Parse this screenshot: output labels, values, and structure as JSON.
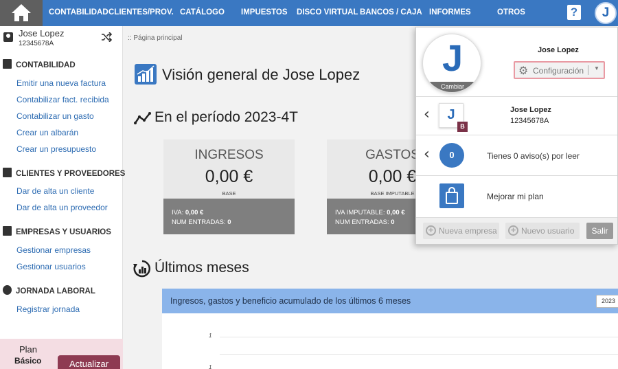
{
  "nav": {
    "items": [
      "CONTABILIDAD",
      "CLIENTES/PROV.",
      "CATÁLOGO",
      "IMPUESTOS",
      "DISCO VIRTUAL",
      "BANCOS / CAJA",
      "INFORMES",
      "OTROS"
    ],
    "help": "?",
    "user_initial": "J"
  },
  "sidebar": {
    "user_name": "Jose Lopez",
    "user_nif": "12345678A",
    "sections": [
      {
        "title": "CONTABILIDAD",
        "links": [
          "Emitir una nueva factura",
          "Contabilizar fact. recibida",
          "Contabilizar un gasto",
          "Crear un albarán",
          "Crear un presupuesto"
        ]
      },
      {
        "title": "CLIENTES Y PROVEEDORES",
        "links": [
          "Dar de alta un cliente",
          "Dar de alta un proveedor"
        ]
      },
      {
        "title": "EMPRESAS Y USUARIOS",
        "links": [
          "Gestionar empresas",
          "Gestionar usuarios"
        ]
      },
      {
        "title": "JORNADA LABORAL",
        "links": [
          "Registrar jornada"
        ]
      }
    ],
    "plan_label": "Plan",
    "plan_name": "Básico",
    "update_button": "Actualizar"
  },
  "main": {
    "breadcrumb": ":: Página principal",
    "title": "Visión general de Jose Lopez",
    "period_title": "En el período 2023-4T",
    "cards": [
      {
        "title": "INGRESOS",
        "value": "0,00 €",
        "sub": "BASE",
        "line1_label": "IVA:",
        "line1_value": "0,00 €",
        "line2_label": "NUM ENTRADAS:",
        "line2_value": "0"
      },
      {
        "title": "GASTOS",
        "value": "0,00 €",
        "sub": "BASE IMPUTABLE",
        "line1_label": "IVA IMPUTABLE:",
        "line1_value": "0,00 €",
        "line2_label": "NUM ENTRADAS:",
        "line2_value": "0"
      }
    ],
    "months_title": "Últimos meses",
    "chart": {
      "title": "Ingresos, gastos y beneficio acumulado de los últimos 6 meses",
      "year": "2023",
      "yticks": [
        "1",
        "1"
      ]
    }
  },
  "user_menu": {
    "avatar_initial": "J",
    "change_label": "Cambiar",
    "name": "Jose Lopez",
    "config_label": "Configuración",
    "company_initial": "J",
    "company_badge": "B",
    "company_name": "Jose Lopez",
    "company_nif": "12345678A",
    "notif_count": "0",
    "notif_text": "Tienes 0 aviso(s) por leer",
    "plan_text": "Mejorar mi plan",
    "new_company": "Nueva empresa",
    "new_user": "Nuevo usuario",
    "logout": "Salir"
  },
  "colors": {
    "nav": "#3a78c2",
    "accent": "#8e3a52",
    "highlight": "#e99aa3"
  }
}
